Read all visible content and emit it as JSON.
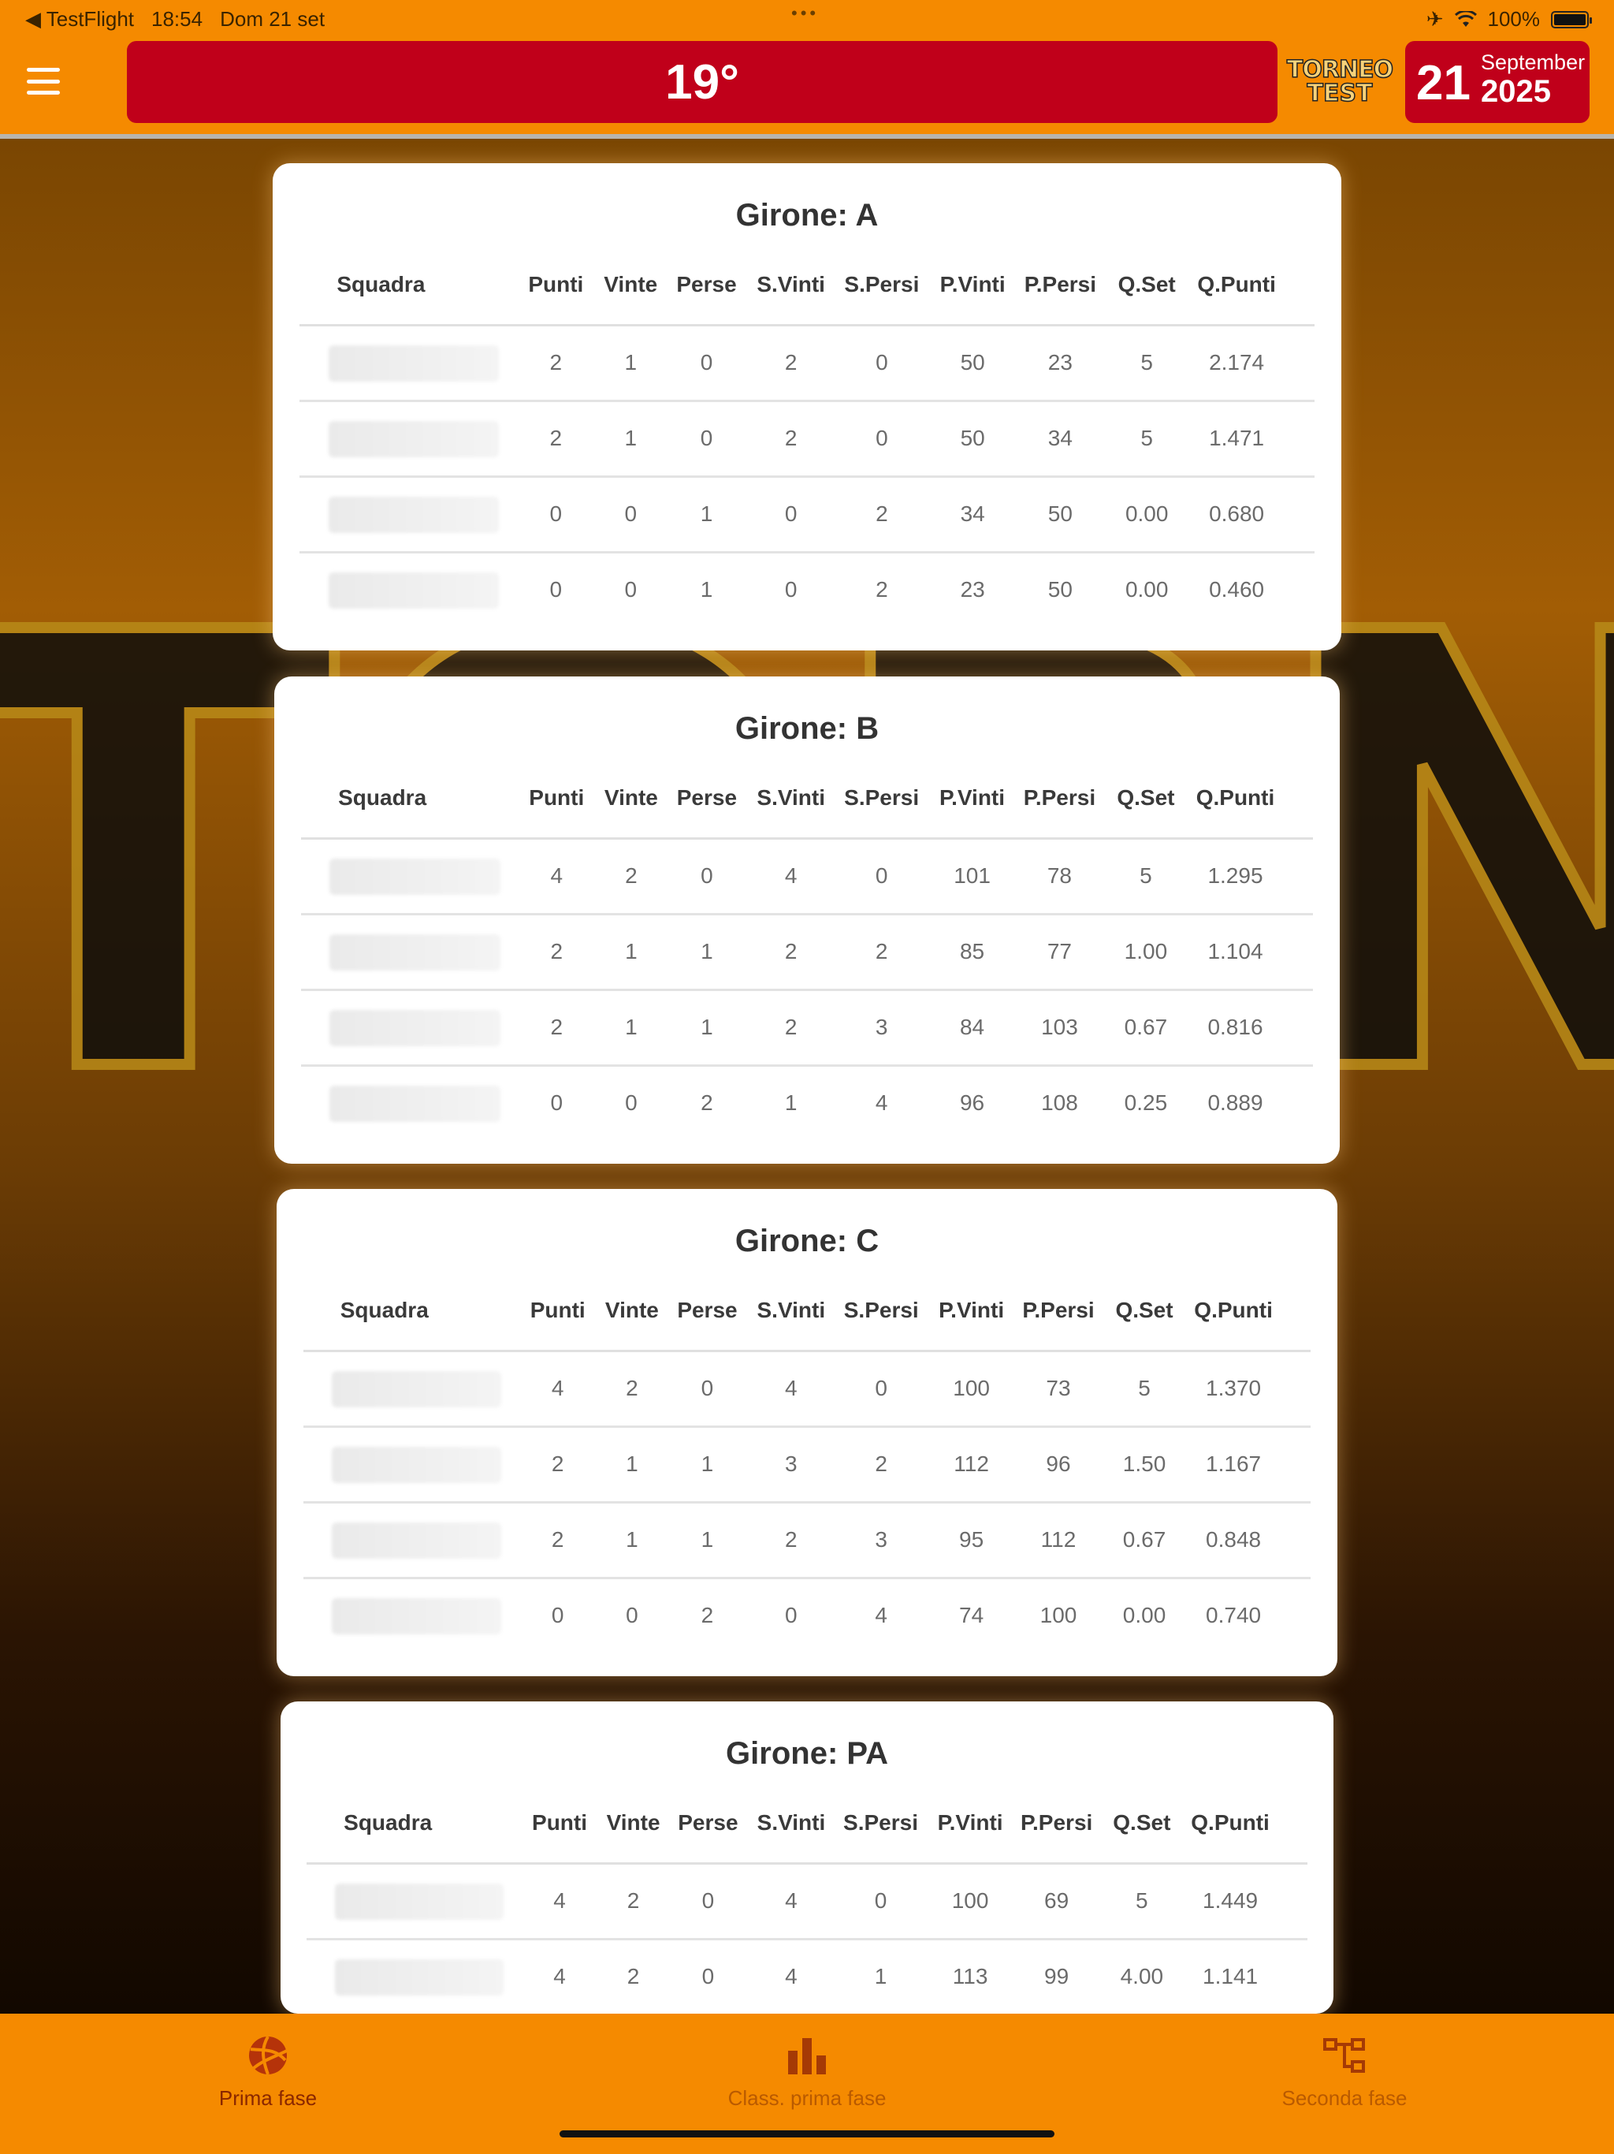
{
  "status_bar": {
    "back_app": "◀ TestFlight",
    "time": "18:54",
    "date": "Dom 21 set",
    "battery": "100%"
  },
  "header": {
    "temperature": "19°",
    "logo_line1": "TORNEO",
    "logo_line2": "TEST",
    "day": "21",
    "month": "September",
    "year": "2025"
  },
  "background_text": "TORNEO",
  "columns": [
    "Squadra",
    "Punti",
    "Vinte",
    "Perse",
    "S.Vinti",
    "S.Persi",
    "P.Vinti",
    "P.Persi",
    "Q.Set",
    "Q.Punti"
  ],
  "groups": [
    {
      "title": "Girone: A",
      "rows": [
        [
          "2",
          "1",
          "0",
          "2",
          "0",
          "50",
          "23",
          "5",
          "2.174"
        ],
        [
          "2",
          "1",
          "0",
          "2",
          "0",
          "50",
          "34",
          "5",
          "1.471"
        ],
        [
          "0",
          "0",
          "1",
          "0",
          "2",
          "34",
          "50",
          "0.00",
          "0.680"
        ],
        [
          "0",
          "0",
          "1",
          "0",
          "2",
          "23",
          "50",
          "0.00",
          "0.460"
        ]
      ]
    },
    {
      "title": "Girone: B",
      "rows": [
        [
          "4",
          "2",
          "0",
          "4",
          "0",
          "101",
          "78",
          "5",
          "1.295"
        ],
        [
          "2",
          "1",
          "1",
          "2",
          "2",
          "85",
          "77",
          "1.00",
          "1.104"
        ],
        [
          "2",
          "1",
          "1",
          "2",
          "3",
          "84",
          "103",
          "0.67",
          "0.816"
        ],
        [
          "0",
          "0",
          "2",
          "1",
          "4",
          "96",
          "108",
          "0.25",
          "0.889"
        ]
      ]
    },
    {
      "title": "Girone: C",
      "rows": [
        [
          "4",
          "2",
          "0",
          "4",
          "0",
          "100",
          "73",
          "5",
          "1.370"
        ],
        [
          "2",
          "1",
          "1",
          "3",
          "2",
          "112",
          "96",
          "1.50",
          "1.167"
        ],
        [
          "2",
          "1",
          "1",
          "2",
          "3",
          "95",
          "112",
          "0.67",
          "0.848"
        ],
        [
          "0",
          "0",
          "2",
          "0",
          "4",
          "74",
          "100",
          "0.00",
          "0.740"
        ]
      ]
    },
    {
      "title": "Girone: PA",
      "rows": [
        [
          "4",
          "2",
          "0",
          "4",
          "0",
          "100",
          "69",
          "5",
          "1.449"
        ],
        [
          "4",
          "2",
          "0",
          "4",
          "1",
          "113",
          "99",
          "4.00",
          "1.141"
        ]
      ]
    }
  ],
  "tabs": [
    {
      "label": "Prima fase",
      "icon": "volleyball-icon",
      "state": "active"
    },
    {
      "label": "Class. prima fase",
      "icon": "bar-chart-icon",
      "state": "inactive"
    },
    {
      "label": "Seconda fase",
      "icon": "bracket-icon",
      "state": "inactive"
    }
  ],
  "colors": {
    "accent": "#F58A00",
    "header_red": "#C0001A"
  }
}
